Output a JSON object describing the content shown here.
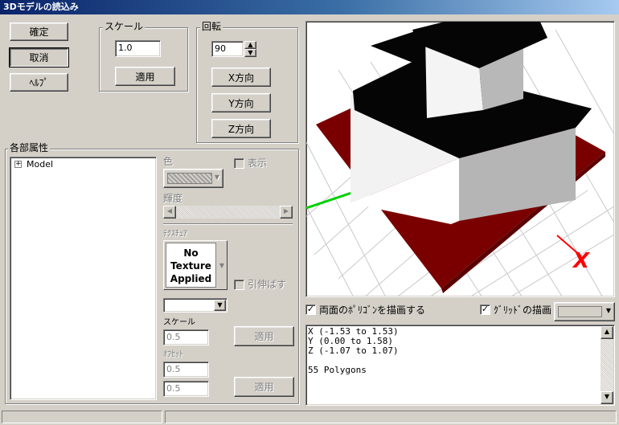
{
  "window": {
    "title": "3Dモデルの読込み"
  },
  "buttons": {
    "confirm": "確定",
    "cancel": "取消",
    "help": "ﾍﾙﾌﾟ"
  },
  "scale": {
    "label": "スケール",
    "value": "1.0",
    "apply": "適用"
  },
  "rotation": {
    "label": "回転",
    "value": "90",
    "x_axis": "X方向",
    "y_axis": "Y方向",
    "z_axis": "Z方向"
  },
  "parts": {
    "label": "各部属性",
    "tree": [
      {
        "expander": "+",
        "label": "Model"
      }
    ],
    "color_label": "色",
    "show_label": "表示",
    "brightness_label": "輝度",
    "texture_label": "ﾃｸｽﾁｭｱ",
    "texture_preview": [
      "No",
      "Texture",
      "Applied"
    ],
    "stretch_label": "引伸ばす",
    "texture_scale_label": "スケール",
    "texture_scale_value": "0.5",
    "texture_scale_apply": "適用",
    "offset_label": "ｵﾌｾｯﾄ",
    "offset_x": "0.5",
    "offset_y": "0.5",
    "offset_apply": "適用"
  },
  "view": {
    "double_sided_label": "両面のﾎﾟﾘｺﾞﾝを描画する",
    "double_sided_checked": true,
    "grid_label": "ｸﾞﾘｯﾄﾞの描画",
    "grid_checked": true,
    "axis_marker": "X"
  },
  "model_info": [
    "X (-1.53 to 1.53)",
    "Y (0.00 to 1.58)",
    "Z (-1.07 to 1.07)",
    "",
    "55 Polygons"
  ],
  "icons": {
    "check": "✓",
    "up": "▲",
    "down": "▼",
    "left": "◀",
    "right": "▶",
    "dropdown": "▼"
  },
  "colors": {
    "title_bar": "#0a246a",
    "base_plane": "#7a0000",
    "roof": "#050505",
    "wall": "#d8d8d8",
    "axis_x": "#ff0000",
    "axis_z": "#00d000"
  }
}
